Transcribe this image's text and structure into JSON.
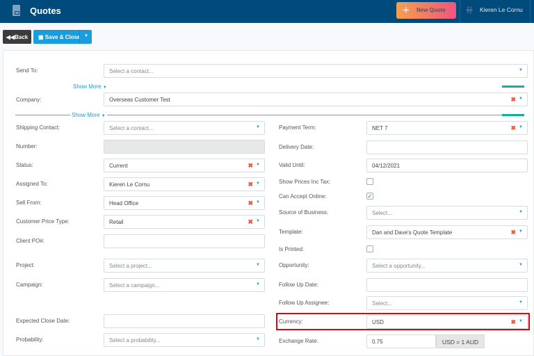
{
  "header": {
    "title": "Quotes",
    "new_quote": "New Quote",
    "user": "Kieren Le Cornu"
  },
  "toolbar": {
    "back": "Back",
    "save_close": "Save & Close"
  },
  "top": {
    "send_to": {
      "label": "Send To:",
      "value": "Select a contact...",
      "placeholder": true
    },
    "show_more_1": "Show More",
    "company": {
      "label": "Company:",
      "value": "Overseas Customer Test"
    },
    "show_more_2": "Show More"
  },
  "left": [
    {
      "label": "Shipping Contact:",
      "type": "select",
      "value": "Select a contact...",
      "placeholder": true
    },
    {
      "label": "Number:",
      "type": "disabled",
      "value": ""
    },
    {
      "label": "Status:",
      "type": "select",
      "value": "Current",
      "clear": true
    },
    {
      "label": "Assigned To:",
      "type": "select",
      "value": "Kieren Le Cornu",
      "clear": true
    },
    {
      "label": "Sell From:",
      "type": "select",
      "value": "Head Office",
      "clear": true
    },
    {
      "label": "Customer Price Type:",
      "type": "select",
      "value": "Retail",
      "clear": true
    },
    {
      "label": "Client PO#:",
      "type": "text",
      "value": ""
    },
    {
      "label": "Project:",
      "type": "select",
      "value": "Select a project...",
      "placeholder": true
    },
    {
      "label": "Campaign:",
      "type": "select",
      "value": "Select a campaign...",
      "placeholder": true
    },
    {
      "label": "Expected Close Date:",
      "type": "text",
      "value": ""
    },
    {
      "label": "Probability:",
      "type": "select",
      "value": "Select a probability...",
      "placeholder": true
    }
  ],
  "right": [
    {
      "label": "Payment Term:",
      "type": "select",
      "value": "NET 7",
      "clear": true
    },
    {
      "label": "Delivery Date:",
      "type": "text",
      "value": ""
    },
    {
      "label": "Valid Until:",
      "type": "text",
      "value": "04/12/2021"
    },
    {
      "label": "Show Prices Inc Tax:",
      "type": "checkbox",
      "checked": false
    },
    {
      "label": "Can Accept Online:",
      "type": "checkbox",
      "checked": true
    },
    {
      "label": "Source of Business:",
      "type": "select",
      "value": "Select...",
      "placeholder": true
    },
    {
      "label": "Template:",
      "type": "select",
      "value": "Dan and Dave's Quote Template",
      "clear": true
    },
    {
      "label": "Is Printed:",
      "type": "checkbox",
      "checked": false
    },
    {
      "label": "Opportunity:",
      "type": "select",
      "value": "Select a opportunity...",
      "placeholder": true
    },
    {
      "label": "Follow Up Date:",
      "type": "text",
      "value": ""
    },
    {
      "label": "Follow Up Assignee:",
      "type": "select",
      "value": "Select...",
      "placeholder": true
    },
    {
      "label": "Currency:",
      "type": "select",
      "value": "USD",
      "clear": true
    },
    {
      "label": "Exchange Rate:",
      "type": "text",
      "value": "0.75",
      "addon": "USD = 1 AUD"
    }
  ],
  "colors": {
    "header": "#004a7c",
    "accent": "#1a9ddc",
    "highlight": "#e8000a"
  }
}
